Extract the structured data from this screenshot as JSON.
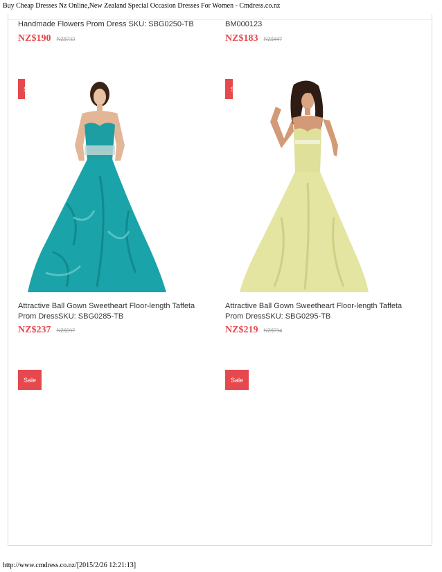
{
  "page": {
    "header": "Buy Cheap Dresses Nz Online,New Zealand Special Occasion Dresses For Women - Cmdress.co.nz",
    "footer": "http://www.cmdress.co.nz/[2015/2/26 12:21:13]"
  },
  "products": [
    {
      "title_lines": [
        "Handmade Flowers Prom Dress SKU: SBG0250-TB"
      ],
      "price": "NZ$190",
      "old_price": "NZ$733"
    },
    {
      "title_lines": [
        "BM000123"
      ],
      "price": "NZ$183",
      "old_price": "NZ$447"
    },
    {
      "sale_label": "Sale",
      "image": "teal-ball-gown-photo",
      "color": "#1aa3a8",
      "title_lines": [
        "Attractive Ball Gown Sweetheart Floor-length Taffeta",
        "Prom DressSKU: SBG0285-TB"
      ],
      "price": "NZ$237",
      "old_price": "NZ$597"
    },
    {
      "sale_label": "Sale",
      "image": "yellow-ball-gown-photo",
      "color": "#e3e5a0",
      "title_lines": [
        "Attractive Ball Gown Sweetheart Floor-length Taffeta",
        "Prom DressSKU: SBG0295-TB"
      ],
      "price": "NZ$219",
      "old_price": "NZ$734"
    },
    {
      "sale_label": "Sale"
    },
    {
      "sale_label": "Sale"
    }
  ],
  "theme": {
    "accent": "#e5484d",
    "text": "#333333",
    "muted": "#999999"
  }
}
